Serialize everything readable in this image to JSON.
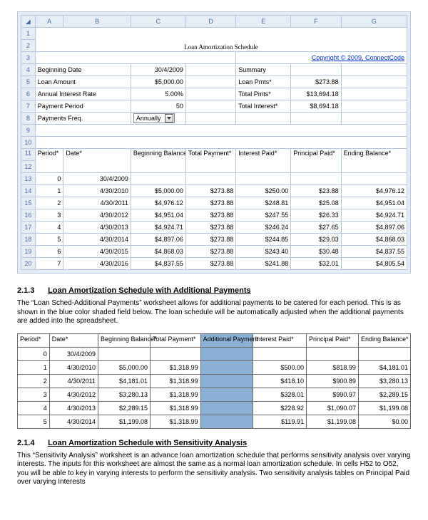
{
  "excel": {
    "cols": [
      "A",
      "B",
      "C",
      "D",
      "E",
      "F",
      "G"
    ],
    "title": "Loan Amortization Schedule",
    "copyright": "Copyright © 2009, ConnectCode",
    "inputs": {
      "beg_date_lbl": "Beginning Date",
      "beg_date_val": "30/4/2009",
      "loan_amt_lbl": "Loan Amount",
      "loan_amt_val": "$5,000.00",
      "rate_lbl": "Annual Interest Rate",
      "rate_val": "5.00%",
      "pmt_period_lbl": "Payment Period",
      "pmt_period_val": "50",
      "freq_lbl": "Payments Freq.",
      "freq_val": "Annually"
    },
    "summary": {
      "header": "Summary",
      "loan_pmts_lbl": "Loan Pmts*",
      "loan_pmts_val": "$273.88",
      "total_pmts_lbl": "Total Pmts*",
      "total_pmts_val": "$13,694.18",
      "total_int_lbl": "Total Interest*",
      "total_int_val": "$8,694.18"
    },
    "sched_hdr": {
      "period": "Period*",
      "date": "Date*",
      "beg_bal": "Beginning Balance*",
      "tot_pmt": "Total Payment*",
      "int_paid": "Interest Paid*",
      "prin_paid": "Principal Paid*",
      "end_bal": "Ending Balance*"
    },
    "sched_rows": [
      {
        "p": "0",
        "d": "30/4/2009",
        "bb": "",
        "tp": "",
        "ip": "",
        "pp": "",
        "eb": ""
      },
      {
        "p": "1",
        "d": "4/30/2010",
        "bb": "$5,000.00",
        "tp": "$273.88",
        "ip": "$250.00",
        "pp": "$23.88",
        "eb": "$4,976.12"
      },
      {
        "p": "2",
        "d": "4/30/2011",
        "bb": "$4,976.12",
        "tp": "$273.88",
        "ip": "$248.81",
        "pp": "$25.08",
        "eb": "$4,951.04"
      },
      {
        "p": "3",
        "d": "4/30/2012",
        "bb": "$4,951.04",
        "tp": "$273.88",
        "ip": "$247.55",
        "pp": "$26.33",
        "eb": "$4,924.71"
      },
      {
        "p": "4",
        "d": "4/30/2013",
        "bb": "$4,924.71",
        "tp": "$273.88",
        "ip": "$246.24",
        "pp": "$27.65",
        "eb": "$4,897.06"
      },
      {
        "p": "5",
        "d": "4/30/2014",
        "bb": "$4,897.06",
        "tp": "$273.88",
        "ip": "$244.85",
        "pp": "$29.03",
        "eb": "$4,868.03"
      },
      {
        "p": "6",
        "d": "4/30/2015",
        "bb": "$4,868.03",
        "tp": "$273.88",
        "ip": "$243.40",
        "pp": "$30.48",
        "eb": "$4,837.55"
      },
      {
        "p": "7",
        "d": "4/30/2016",
        "bb": "$4,837.55",
        "tp": "$273.88",
        "ip": "$241.88",
        "pp": "$32.01",
        "eb": "$4,805.54"
      }
    ]
  },
  "sec213": {
    "num": "2.1.3",
    "title": "Loan Amortization Schedule with Additional Payments",
    "body": "The “Loan Sched-Additional Payments” worksheet allows for additional payments to be catered for each period. This is as shown in the blue color shaded field below. The loan schedule will be automatically adjusted when the additional payments are added into the spreadsheet.",
    "hdr": {
      "period": "Period*",
      "date": "Date*",
      "beg": "Beginning Balance*",
      "tot": "Total Payment*",
      "add": "Additional Payment",
      "int": "Interest Paid*",
      "prin": "Principal Paid*",
      "end": "Ending Balance*"
    },
    "rows": [
      {
        "p": "0",
        "d": "30/4/2009",
        "bb": "",
        "tp": "",
        "ap": "",
        "ip": "",
        "pp": "",
        "eb": ""
      },
      {
        "p": "1",
        "d": "4/30/2010",
        "bb": "$5,000.00",
        "tp": "$1,318.99",
        "ap": "",
        "ip": "$500.00",
        "pp": "$818.99",
        "eb": "$4,181.01"
      },
      {
        "p": "2",
        "d": "4/30/2011",
        "bb": "$4,181.01",
        "tp": "$1,318.99",
        "ap": "",
        "ip": "$418.10",
        "pp": "$900.89",
        "eb": "$3,280.13"
      },
      {
        "p": "3",
        "d": "4/30/2012",
        "bb": "$3,280.13",
        "tp": "$1,318.99",
        "ap": "",
        "ip": "$328.01",
        "pp": "$990.97",
        "eb": "$2,289.15"
      },
      {
        "p": "4",
        "d": "4/30/2013",
        "bb": "$2,289.15",
        "tp": "$1,318.99",
        "ap": "",
        "ip": "$228.92",
        "pp": "$1,090.07",
        "eb": "$1,199.08"
      },
      {
        "p": "5",
        "d": "4/30/2014",
        "bb": "$1,199.08",
        "tp": "$1,318.99",
        "ap": "",
        "ip": "$119.91",
        "pp": "$1,199.08",
        "eb": "$0.00"
      }
    ]
  },
  "sec214": {
    "num": "2.1.4",
    "title": "Loan Amortization Schedule with Sensitivity Analysis",
    "body": "This “Sensitivity Analysis” worksheet is an advance loan amortization schedule that performs sensitivity analysis over varying interests. The inputs for this worksheet are almost the same as a normal loan amortization schedule. In cells H52 to O52, you will be able to key in varying interests to perform the sensitivity analysis. Two sensitivity analysis tables on Principal Paid over varying Interests"
  }
}
